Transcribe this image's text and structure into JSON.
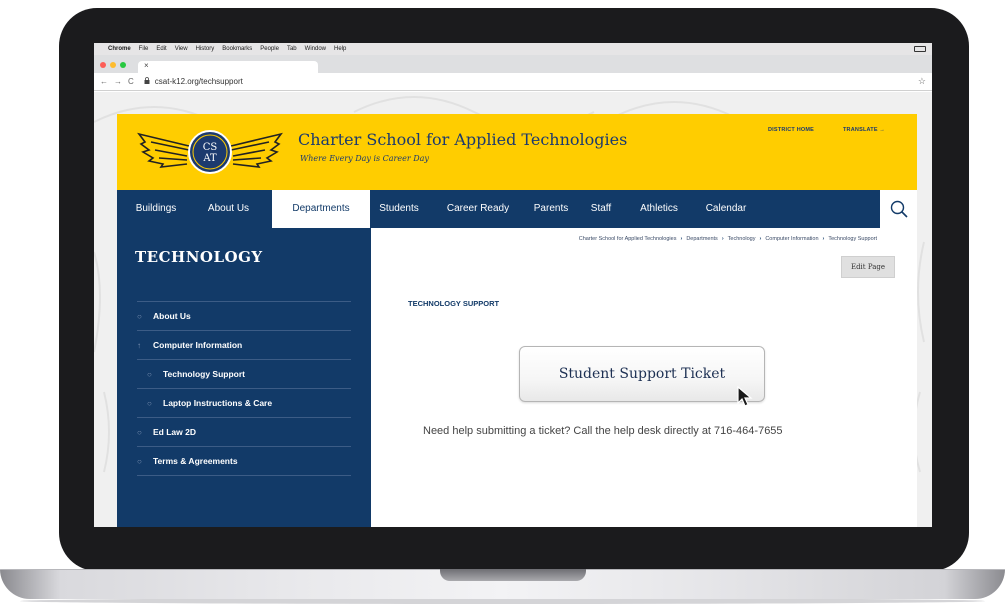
{
  "menubar": {
    "apple": "",
    "items": [
      "Chrome",
      "File",
      "Edit",
      "View",
      "History",
      "Bookmarks",
      "People",
      "Tab",
      "Window",
      "Help"
    ]
  },
  "browser": {
    "tab_close": "×",
    "url": "csat-k12.org/techsupport",
    "back": "←",
    "forward": "→",
    "reload": "C",
    "star": "☆"
  },
  "header": {
    "school_name": "Charter School for Applied Technologies",
    "tagline": "Where Every Day is Career Day",
    "logo_text": "CSAT",
    "district_home": "DISTRICT HOME",
    "translate": "TRANSLATE →"
  },
  "nav": {
    "items": [
      "Buildings",
      "About Us",
      "Departments",
      "Students",
      "Career Ready",
      "Parents",
      "Staff",
      "Athletics",
      "Calendar"
    ],
    "active": "Departments"
  },
  "sidebar": {
    "title": "TECHNOLOGY",
    "items": [
      {
        "label": "About Us",
        "bullet": "○"
      },
      {
        "label": "Computer Information",
        "bullet": "↑"
      },
      {
        "label": "Technology Support",
        "bullet": "○"
      },
      {
        "label": "Laptop Instructions & Care",
        "bullet": "○"
      },
      {
        "label": "Ed Law 2D",
        "bullet": "○"
      },
      {
        "label": "Terms & Agreements",
        "bullet": "○"
      }
    ]
  },
  "content": {
    "breadcrumb": [
      "Charter School for Applied Technologies",
      "Departments",
      "Technology",
      "Computer Information",
      "Technology Support"
    ],
    "breadcrumb_sep": "›",
    "edit_page": "Edit Page",
    "heading": "TECHNOLOGY SUPPORT",
    "ticket_button": "Student Support Ticket",
    "help_text": "Need help submitting a ticket? Call the help desk directly at 716-464-7655"
  },
  "colors": {
    "brand_navy": "#123a68",
    "brand_gold": "#ffcd00"
  }
}
